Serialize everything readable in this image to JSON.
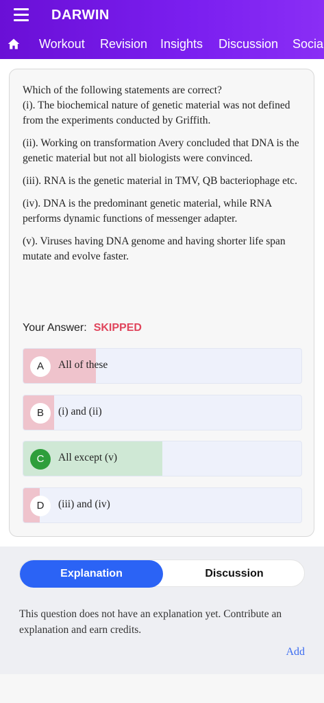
{
  "app": {
    "title": "DARWIN"
  },
  "nav": {
    "icons": {
      "menu": "hamburger-icon",
      "home": "home-icon"
    },
    "tabs": [
      "Workout",
      "Revision",
      "Insights",
      "Discussion",
      "Social"
    ]
  },
  "question": {
    "stem": "Which of the following statements are correct?",
    "statements": [
      "(i). The biochemical nature of genetic material was not defined from the experiments conducted by Griffith.",
      "(ii). Working on transformation Avery concluded that DNA is the genetic material but not all biologists were convinced.",
      "(iii). RNA is the genetic material in TMV, QB bacteriophage etc.",
      "(iv). DNA is the predominant genetic material, while RNA performs dynamic functions of messenger adapter.",
      "(v). Viruses having DNA genome and having shorter life span mutate and evolve faster."
    ]
  },
  "answer": {
    "label": "Your Answer:",
    "status": "SKIPPED"
  },
  "options": [
    {
      "letter": "A",
      "text": "All of these",
      "response_share": 0.26,
      "result": "wrong"
    },
    {
      "letter": "B",
      "text": "(i) and (ii)",
      "response_share": 0.11,
      "result": "wrong"
    },
    {
      "letter": "C",
      "text": "All except (v)",
      "response_share": 0.5,
      "result": "correct"
    },
    {
      "letter": "D",
      "text": "(iii) and (iv)",
      "response_share": 0.06,
      "result": "wrong"
    }
  ],
  "colors": {
    "primary": "#6a0fd6",
    "accent": "#2b63f5",
    "wrong_fill": "#efc3cc",
    "correct_fill": "#cfe8d5",
    "correct_badge": "#2e9e3b",
    "skipped": "#e0455c"
  },
  "lower": {
    "toggle": {
      "explanation": "Explanation",
      "discussion": "Discussion",
      "selected": "Explanation"
    },
    "message": "This question does not have an explanation yet. Contribute an explanation and earn credits.",
    "add_link": "Add"
  }
}
